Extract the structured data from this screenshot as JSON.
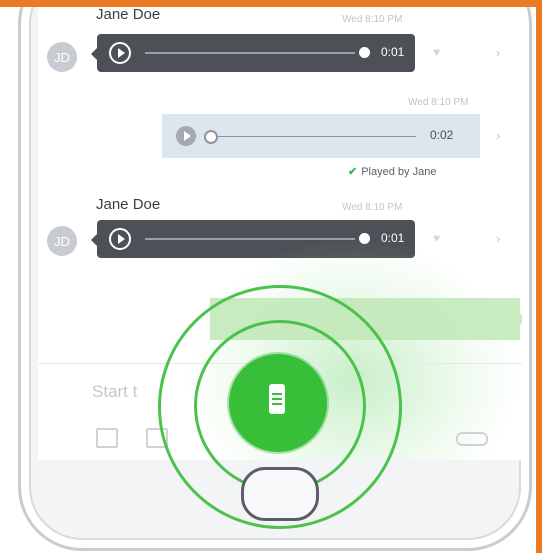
{
  "colors": {
    "accent_top": "#ea7b24",
    "brand_green": "#38bf3a",
    "bubble_dark": "#4d5157",
    "bubble_light": "#dde5ef"
  },
  "messages": [
    {
      "sender": "Jane Doe",
      "avatar_initials": "JD",
      "timestamp": "Wed 8:10 PM",
      "duration": "0:01",
      "direction": "incoming",
      "play_icon": "play-icon",
      "heart_icon": "heart-icon"
    },
    {
      "timestamp": "Wed 8:10 PM",
      "duration": "0:02",
      "direction": "outgoing",
      "status": "Played by Jane",
      "status_icon": "check-icon"
    },
    {
      "sender": "Jane Doe",
      "avatar_initials": "JD",
      "timestamp": "Wed 8:10 PM",
      "duration": "0:01",
      "direction": "incoming"
    }
  ],
  "compose": {
    "placeholder": "Start t",
    "icons": [
      "image-icon",
      "file-icon",
      "keyboard-icon"
    ]
  },
  "ptt_button": {
    "icon": "walkie-talkie-icon"
  },
  "home_button": {
    "icon": "home-button"
  }
}
